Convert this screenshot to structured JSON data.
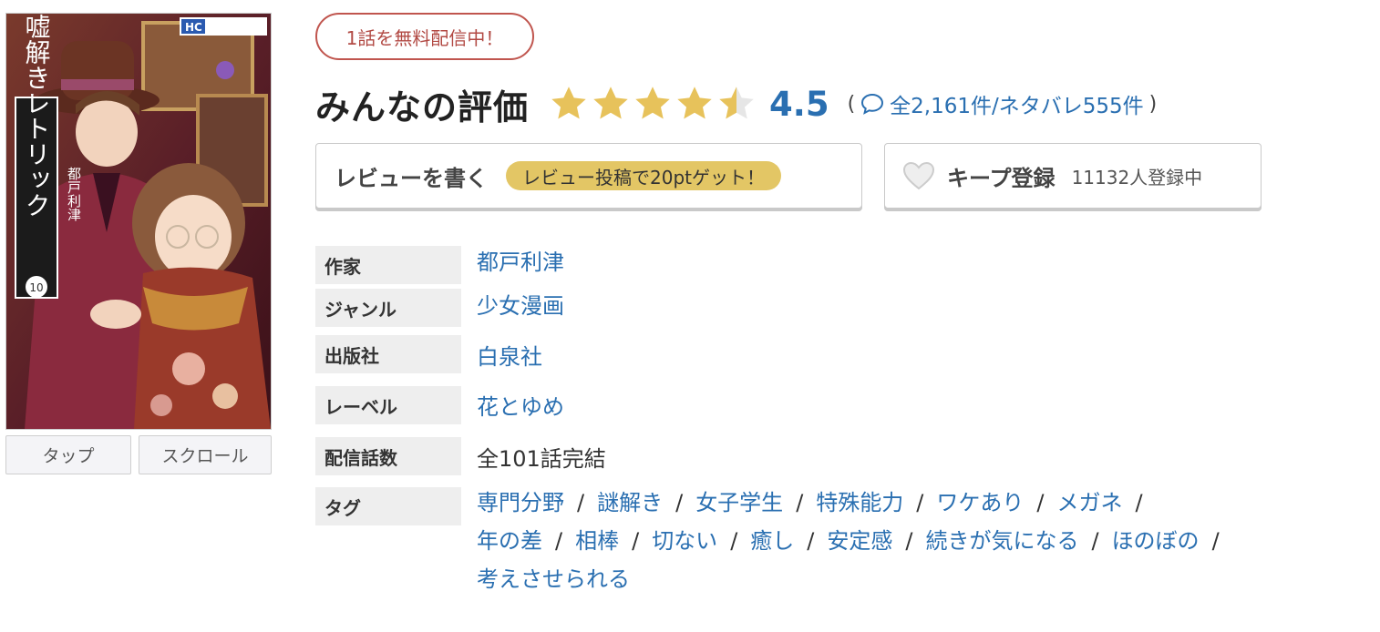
{
  "colors": {
    "link": "#2a6fb1",
    "badge_border": "#c0554e",
    "star": "#e7c25b",
    "point_pill": "#e3c665"
  },
  "cover": {
    "publisher_logo": "HC",
    "series_title": "嘘解きレトリック",
    "author": "都戸利津",
    "volume": "10"
  },
  "reader_buttons": {
    "tap": "タップ",
    "scroll": "スクロール"
  },
  "free_badge": "1話を無料配信中！",
  "rating": {
    "title": "みんなの評価",
    "stars": 4.5,
    "score": "4.5",
    "paren_open": "(",
    "paren_close": ")",
    "counts": "全2,161件/ネタバレ555件",
    "icon": "speech-bubble-icon"
  },
  "review_button": {
    "label": "レビューを書く",
    "point": "レビュー投稿で20ptゲット！"
  },
  "keep_button": {
    "icon": "heart-icon",
    "label": "キープ登録",
    "count": "11132人登録中"
  },
  "info": {
    "author_label": "作家",
    "author": "都戸利津",
    "genre_label": "ジャンル",
    "genre": "少女漫画",
    "publisher_label": "出版社",
    "publisher": "白泉社",
    "label_label": "レーベル",
    "label": "花とゆめ",
    "episodes_label": "配信話数",
    "episodes": "全101話完結",
    "tags_label": "タグ"
  },
  "tags": [
    "専門分野",
    "謎解き",
    "女子学生",
    "特殊能力",
    "ワケあり",
    "メガネ",
    "年の差",
    "相棒",
    "切ない",
    "癒し",
    "安定感",
    "続きが気になる",
    "ほのぼの",
    "考えさせられる"
  ],
  "tag_separator": "/"
}
